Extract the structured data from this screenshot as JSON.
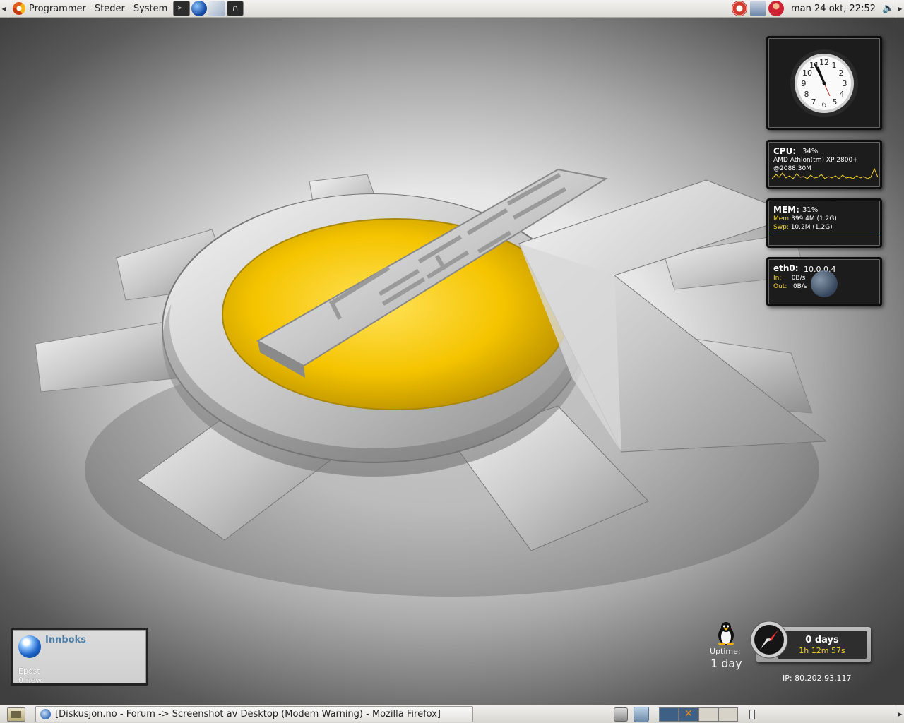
{
  "top_panel": {
    "menu_applications": "Programmer",
    "menu_places": "Steder",
    "menu_system": "System",
    "clock": "man 24 okt, 22:52",
    "terminal_glyph": ">_"
  },
  "clock_face": {
    "numbers": [
      "12",
      "1",
      "2",
      "3",
      "4",
      "5",
      "6",
      "7",
      "8",
      "9",
      "10",
      "11"
    ]
  },
  "cpu_widget": {
    "title": "CPU:",
    "percent": "34%",
    "model": "AMD Athlon(tm) XP 2800+",
    "speed": "@2088.30M"
  },
  "mem_widget": {
    "title": "MEM:",
    "percent": "31%",
    "mem_label": "Mem:",
    "mem_value": "399.4M (1.2G)",
    "swap_label": "Swp:",
    "swap_value": "10.2M (1.2G)"
  },
  "net_widget": {
    "title": "eth0:",
    "address": "10.0.0.4",
    "in_label": "In:",
    "in_value": "0B/s",
    "out_label": "Out:",
    "out_value": "0B/s"
  },
  "mail_widget": {
    "title": "Innboks",
    "account": "Epost",
    "count": "0 new"
  },
  "uptime_widget": {
    "label": "Uptime:",
    "value": "1 day",
    "days": "0 days",
    "time": "1h 12m 57s",
    "ip": "IP: 80.202.93.117"
  },
  "bottom_panel": {
    "task_title": "[Diskusjon.no - Forum -> Screenshot av Desktop (Modem Warning) - Mozilla Firefox]"
  },
  "colors": {
    "wallpaper_yellow": "#f5c400",
    "widget_accent": "#f2d22c",
    "workspace_active": "#3f5f84"
  }
}
